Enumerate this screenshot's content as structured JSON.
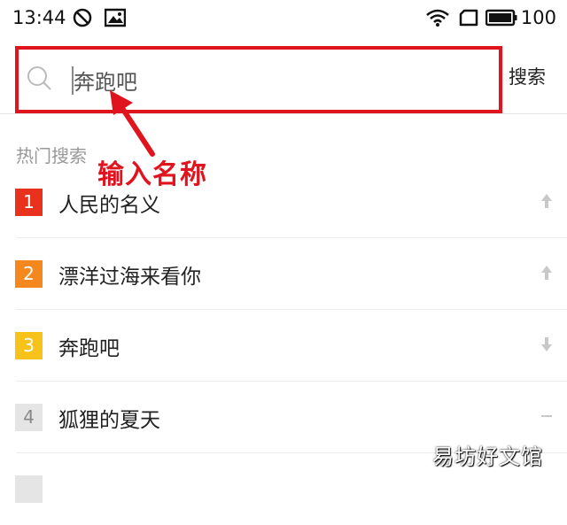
{
  "status_bar": {
    "time": "13:44",
    "battery": "100",
    "icons": [
      "do-not-disturb-icon",
      "image-icon",
      "wifi-icon",
      "screen-rotate-icon",
      "battery-icon"
    ]
  },
  "search": {
    "query": "奔跑吧",
    "button_label": "搜索"
  },
  "annotation": {
    "text": "输入名称",
    "color": "#e0141e"
  },
  "hot_section": {
    "title": "热门搜索",
    "items": [
      {
        "rank": "1",
        "label": "人民的名义",
        "rank_color": "#e8321e",
        "trend": "up-arrow-icon"
      },
      {
        "rank": "2",
        "label": "漂洋过海来看你",
        "rank_color": "#f5871f",
        "trend": "up-arrow-icon"
      },
      {
        "rank": "3",
        "label": "奔跑吧",
        "rank_color": "#f7c21a",
        "trend": "down-arrow-icon"
      },
      {
        "rank": "4",
        "label": "狐狸的夏天",
        "rank_color": "#e5e5e5",
        "trend": "dash-icon"
      }
    ]
  },
  "watermark": "易坊好文馆"
}
